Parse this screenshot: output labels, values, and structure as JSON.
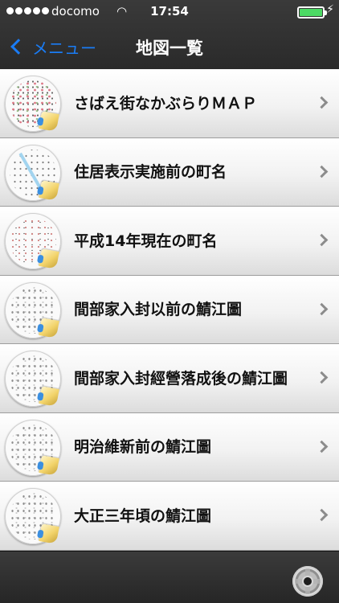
{
  "status_bar": {
    "carrier": "docomo",
    "time": "17:54"
  },
  "nav": {
    "back_label": "メニュー",
    "title": "地図一覧"
  },
  "maps": [
    {
      "label": "さばえ街なかぶらりＭＡＰ"
    },
    {
      "label": "住居表示実施前の町名"
    },
    {
      "label": "平成14年現在の町名"
    },
    {
      "label": "間部家入封以前の鯖江圖"
    },
    {
      "label": "間部家入封經營落成後の鯖江圖"
    },
    {
      "label": "明治維新前の鯖江圖"
    },
    {
      "label": "大正三年頃の鯖江圖"
    }
  ],
  "icons": {
    "back": "chevron-left-icon",
    "disclosure": "chevron-right-icon",
    "settings": "gear-icon"
  },
  "colors": {
    "accent": "#1a7cf5",
    "battery": "#4cd964",
    "bar": "#2b2b2b"
  }
}
